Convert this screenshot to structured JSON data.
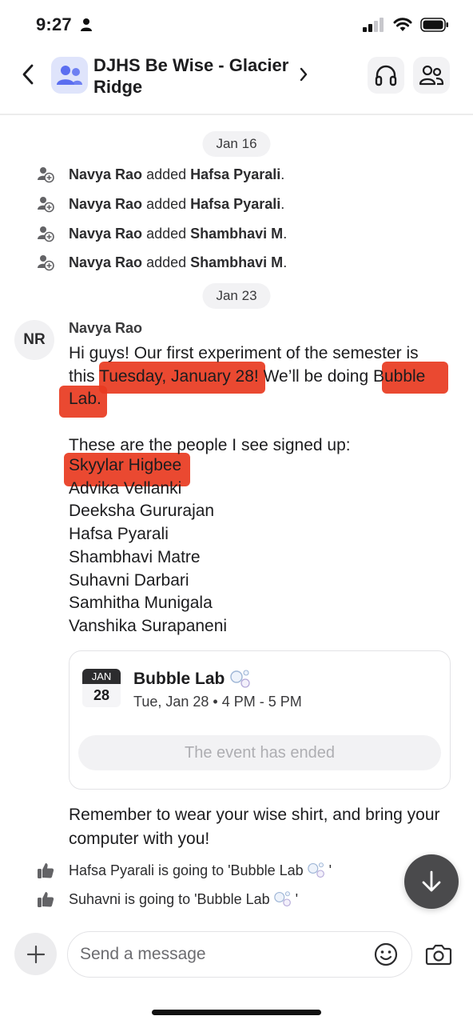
{
  "status_bar": {
    "time": "9:27"
  },
  "header": {
    "title": "DJHS Be Wise - Glacier Ridge"
  },
  "feed": {
    "date_separators": [
      "Jan 16",
      "Jan 23"
    ],
    "system_events": [
      {
        "actor": "Navya Rao",
        "verb": "added",
        "target": "Hafsa Pyarali",
        "suffix": "."
      },
      {
        "actor": "Navya Rao",
        "verb": "added",
        "target": "Hafsa Pyarali",
        "suffix": "."
      },
      {
        "actor": "Navya Rao",
        "verb": "added",
        "target": "Shambhavi M",
        "suffix": "."
      },
      {
        "actor": "Navya Rao",
        "verb": "added",
        "target": "Shambhavi M",
        "suffix": "."
      }
    ],
    "message": {
      "avatar_initials": "NR",
      "sender": "Navya Rao",
      "line1": "Hi guys! Our first experiment of the semester is",
      "line2_pre": "this ",
      "line2_date": "Tuesday, January 28",
      "line2_mid": "! We’ll be doing ",
      "line2_bubble": "Bubble",
      "line3": "Lab.",
      "intro": "These are the people I see signed up:",
      "names": [
        "Skyylar Higbee",
        "Advika Vellanki",
        "Deeksha Gururajan",
        "Hafsa Pyarali",
        "Shambhavi Matre",
        "Suhavni Darbari",
        "Samhitha Munigala",
        "Vanshika Surapaneni"
      ]
    },
    "event": {
      "month": "JAN",
      "day": "28",
      "title": "Bubble Lab",
      "time": "Tue, Jan 28 • 4 PM - 5 PM",
      "status": "The event has ended"
    },
    "closing_message": "Remember to wear your wise shirt, and bring your computer with you!",
    "rsvps": [
      {
        "text": "Hafsa Pyarali is going to 'Bubble Lab",
        "end": "'"
      },
      {
        "text": "Suhavni is going to 'Bubble Lab",
        "end": "'"
      }
    ]
  },
  "composer": {
    "placeholder": "Send a message"
  },
  "colors": {
    "highlight": "#e8391f",
    "avatar_bg": "#dfe4fb",
    "avatar_icon": "#5b6ef0"
  },
  "icons": [
    "person-icon",
    "signal-icon",
    "wifi-icon",
    "battery-icon",
    "back-icon",
    "group-icon",
    "chevron-right-icon",
    "headset-icon",
    "members-icon",
    "member-added-icon",
    "bubbles-icon",
    "thumbs-up-icon",
    "arrow-down-icon",
    "plus-icon",
    "emoji-icon",
    "camera-icon"
  ]
}
